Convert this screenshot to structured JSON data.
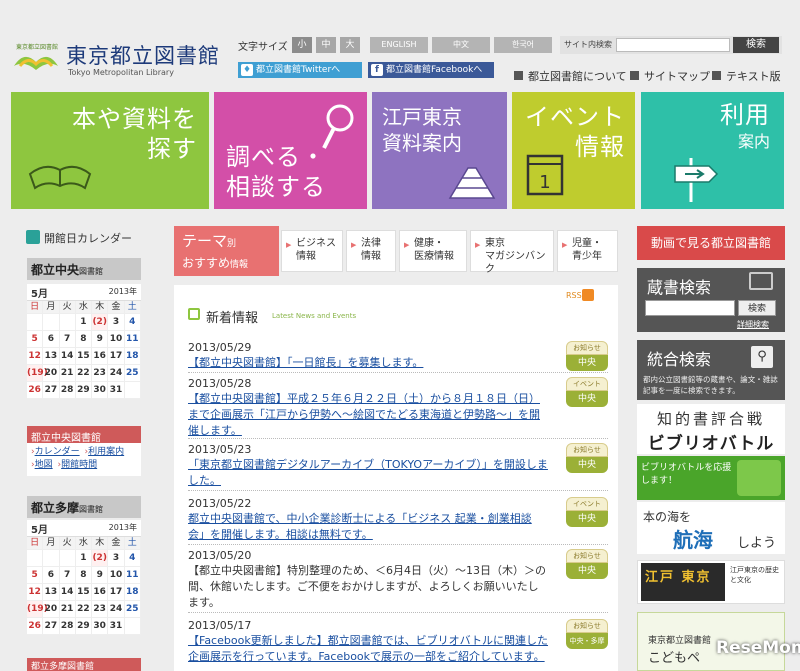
{
  "header": {
    "logo_jp": "東京都立図書館",
    "logo_en": "Tokyo Metropolitan Library",
    "logo_small": "東京都立図書館",
    "font_size_label": "文字サイズ",
    "font_sizes": [
      "小",
      "中",
      "大"
    ],
    "languages": [
      "ENGLISH",
      "中文",
      "한국어"
    ],
    "search_label": "サイト内検索",
    "search_button": "検索",
    "twitter": "都立図書館Twitterへ",
    "facebook": "都立図書館Facebookへ",
    "nav": [
      "都立図書館について",
      "サイトマップ",
      "テキスト版"
    ]
  },
  "tiles": [
    {
      "label": "本や資料を探す",
      "line1": "本や資料を",
      "line2": "探す",
      "color": "#8ec63f"
    },
    {
      "label": "調べる・相談する",
      "line1": "調べる・",
      "line2": "相談する",
      "color": "#d34fa8"
    },
    {
      "label": "江戸東京資料案内",
      "line1": "江戸東京",
      "line2": "資料案内",
      "color": "#8e73c0"
    },
    {
      "label": "イベント情報",
      "line1": "イベント",
      "line2": "情報",
      "color": "#bfcc2e"
    },
    {
      "label": "利用案内",
      "line1": "利用",
      "line2": "案内",
      "color": "#2ec0a8"
    }
  ],
  "calendar": {
    "heading": "開館日カレンダー",
    "days_of_week": [
      "日",
      "月",
      "火",
      "水",
      "木",
      "金",
      "土"
    ],
    "central": {
      "name": "都立中央",
      "suffix": "図書館",
      "month": "5月",
      "year": "2013年",
      "weeks": [
        [
          "",
          "",
          "",
          "1",
          "(2)",
          "3",
          "4"
        ],
        [
          "5",
          "6",
          "7",
          "8",
          "9",
          "10",
          "11"
        ],
        [
          "12",
          "13",
          "14",
          "15",
          "16",
          "17",
          "18"
        ],
        [
          "(19)",
          "20",
          "21",
          "22",
          "23",
          "24",
          "25"
        ],
        [
          "26",
          "27",
          "28",
          "29",
          "30",
          "31",
          ""
        ]
      ]
    },
    "tama": {
      "name": "都立多摩",
      "suffix": "図書館",
      "month": "5月",
      "year": "2013年",
      "weeks": [
        [
          "",
          "",
          "",
          "1",
          "(2)",
          "3",
          "4"
        ],
        [
          "5",
          "6",
          "7",
          "8",
          "9",
          "10",
          "11"
        ],
        [
          "12",
          "13",
          "14",
          "15",
          "16",
          "17",
          "18"
        ],
        [
          "(19)",
          "20",
          "21",
          "22",
          "23",
          "24",
          "25"
        ],
        [
          "26",
          "27",
          "28",
          "29",
          "30",
          "31",
          ""
        ]
      ]
    }
  },
  "central_library_box": {
    "heading": "都立中央図書館",
    "links": [
      "カレンダー",
      "利用案内",
      "地図",
      "開館時間"
    ]
  },
  "tama_library_box": {
    "heading": "都立多摩図書館"
  },
  "theme": {
    "title_a": "テーマ",
    "title_b": "別",
    "title_c": "おすすめ",
    "title_d": "情報",
    "items": [
      [
        "ビジネス",
        "情報"
      ],
      [
        "法律",
        "情報"
      ],
      [
        "健康・",
        "医療情報"
      ],
      [
        "東京",
        "マガジンバンク"
      ],
      [
        "児童・",
        "青少年"
      ]
    ]
  },
  "news": {
    "title": "新着情報",
    "subtitle": "Latest News and Events",
    "rss": "RSS",
    "items": [
      {
        "date": "2013/05/29",
        "text": "【都立中央図書館】「一日館長」を募集します。",
        "link": true,
        "badge_top": "お知らせ",
        "badge_bottom": "中央"
      },
      {
        "date": "2013/05/28",
        "text": "【都立中央図書館】平成２５年６月２２日（土）から８月１８日（日）まで企画展示「江戸から伊勢へ～絵図でたどる東海道と伊勢路～」を開催します。",
        "link": true,
        "badge_top": "イベント",
        "badge_bottom": "中央"
      },
      {
        "date": "2013/05/23",
        "text": "「東京都立図書館デジタルアーカイブ（TOKYOアーカイブ）」を開設しました。",
        "link": true,
        "badge_top": "お知らせ",
        "badge_bottom": "中央"
      },
      {
        "date": "2013/05/22",
        "text": "都立中央図書館で、中小企業診断士による「ビジネス 起業・創業相談会」を開催します。相談は無料です。",
        "link": true,
        "badge_top": "イベント",
        "badge_bottom": "中央"
      },
      {
        "date": "2013/05/20",
        "text": "【都立中央図書館】特別整理のため、＜6月4日（火）～13日（木）＞の間、休館いたします。ご不便をおかけしますが、よろしくお願いいたします。",
        "link": false,
        "badge_top": "お知らせ",
        "badge_bottom": "中央"
      },
      {
        "date": "2013/05/17",
        "text": "【Facebook更新しました】都立図書館では、ビブリオバトルに関連した企画展示を行っています。Facebookで展示の一部をご紹介しています。",
        "link": true,
        "badge_top": "お知らせ",
        "badge_bottom": "中央・多摩"
      }
    ]
  },
  "right": {
    "video_button": "動画で見る都立図書館",
    "zosho_title": "蔵書検索",
    "zosho_button": "検索",
    "zosho_advanced": "詳細検索",
    "togo_title": "統合検索",
    "togo_desc": "都内公立図書館等の蔵書や、論文・雑誌記事を一度に検索できます。",
    "biblio_a": "知的書評合戦",
    "biblio_b": "ビブリオバトル",
    "oen": "ビブリオバトルを応援します！",
    "umi_a": "本の海を",
    "umi_b": "航海",
    "umi_c": "しよう",
    "edo_a": "江戸 東京",
    "edo_b": "江戸東京の歴史と文化",
    "kodomo_a": "東京都立図書館",
    "kodomo_b": "こどもペ"
  },
  "watermark": "ReseMom"
}
